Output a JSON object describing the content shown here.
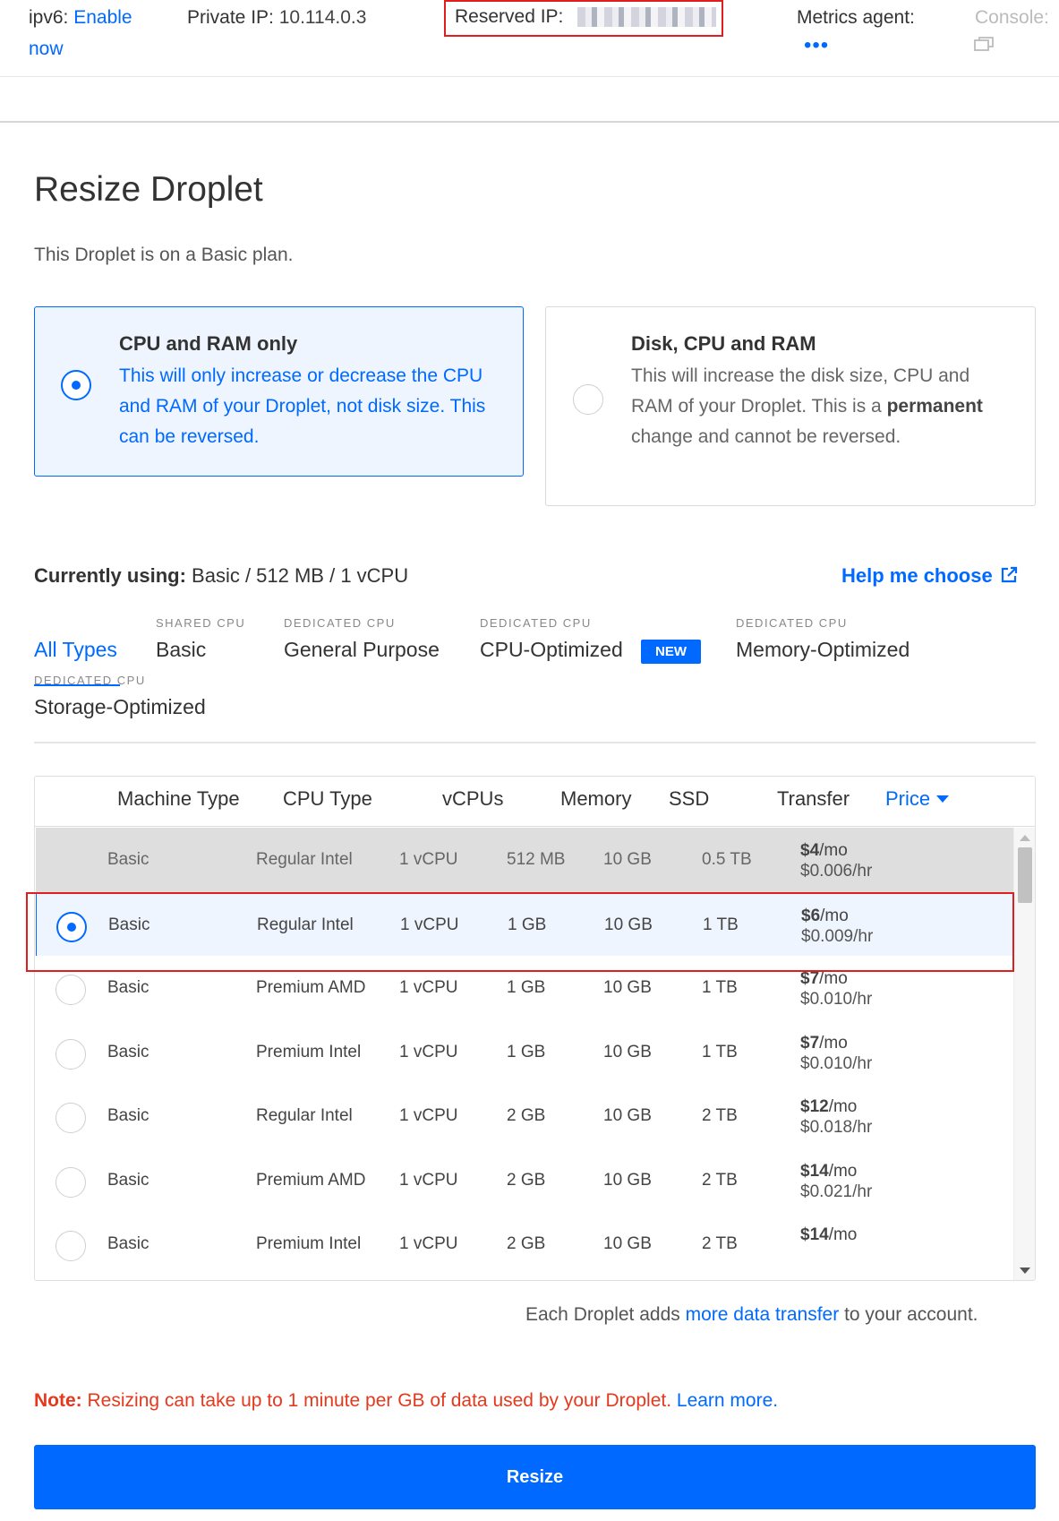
{
  "topbar": {
    "ipv6_label": "ipv6:",
    "ipv6_link": "Enable now",
    "private_ip_label": "Private IP:",
    "private_ip_value": "10.114.0.3",
    "reserved_ip_label": "Reserved IP:",
    "metrics_label": "Metrics agent:",
    "metrics_value": "•••",
    "console_label": "Console:"
  },
  "page": {
    "title": "Resize Droplet",
    "plan_note": "This Droplet is on a Basic plan."
  },
  "options": [
    {
      "title": "CPU and RAM only",
      "description": "This will only increase or decrease the CPU and RAM of your Droplet, not disk size. This can be reversed.",
      "selected": true
    },
    {
      "title": "Disk, CPU and RAM",
      "description_pre": "This will increase the disk size, CPU and RAM of your Droplet. This is a",
      "description_bold": "permanent",
      "description_post": "change and cannot be reversed.",
      "selected": false
    }
  ],
  "current": {
    "label": "Currently using:",
    "value": "Basic / 512 MB / 1 vCPU",
    "help_link": "Help me choose"
  },
  "tabs": [
    {
      "kicker": "",
      "label": "All Types",
      "active": true
    },
    {
      "kicker": "SHARED CPU",
      "label": "Basic",
      "active": false
    },
    {
      "kicker": "DEDICATED CPU",
      "label": "General Purpose",
      "active": false
    },
    {
      "kicker": "DEDICATED CPU",
      "label": "CPU-Optimized",
      "active": false,
      "badge": "NEW"
    },
    {
      "kicker": "DEDICATED CPU",
      "label": "Memory-Optimized",
      "active": false
    },
    {
      "kicker": "DEDICATED CPU",
      "label": "Storage-Optimized",
      "active": false
    }
  ],
  "table": {
    "headers": [
      "Machine Type",
      "CPU Type",
      "vCPUs",
      "Memory",
      "SSD",
      "Transfer",
      "Price"
    ],
    "rows": [
      {
        "machine": "Basic",
        "cpu": "Regular Intel",
        "vcpus": "1 vCPU",
        "memory": "512 MB",
        "ssd": "10 GB",
        "transfer": "0.5 TB",
        "price_mo": "$4",
        "price_mo_unit": "/mo",
        "price_hr": "$0.006/hr",
        "state": "current"
      },
      {
        "machine": "Basic",
        "cpu": "Regular Intel",
        "vcpus": "1 vCPU",
        "memory": "1 GB",
        "ssd": "10 GB",
        "transfer": "1 TB",
        "price_mo": "$6",
        "price_mo_unit": "/mo",
        "price_hr": "$0.009/hr",
        "state": "selected"
      },
      {
        "machine": "Basic",
        "cpu": "Premium AMD",
        "vcpus": "1 vCPU",
        "memory": "1 GB",
        "ssd": "10 GB",
        "transfer": "1 TB",
        "price_mo": "$7",
        "price_mo_unit": "/mo",
        "price_hr": "$0.010/hr",
        "state": "none"
      },
      {
        "machine": "Basic",
        "cpu": "Premium Intel",
        "vcpus": "1 vCPU",
        "memory": "1 GB",
        "ssd": "10 GB",
        "transfer": "1 TB",
        "price_mo": "$7",
        "price_mo_unit": "/mo",
        "price_hr": "$0.010/hr",
        "state": "none"
      },
      {
        "machine": "Basic",
        "cpu": "Regular Intel",
        "vcpus": "1 vCPU",
        "memory": "2 GB",
        "ssd": "10 GB",
        "transfer": "2 TB",
        "price_mo": "$12",
        "price_mo_unit": "/mo",
        "price_hr": "$0.018/hr",
        "state": "none"
      },
      {
        "machine": "Basic",
        "cpu": "Premium AMD",
        "vcpus": "1 vCPU",
        "memory": "2 GB",
        "ssd": "10 GB",
        "transfer": "2 TB",
        "price_mo": "$14",
        "price_mo_unit": "/mo",
        "price_hr": "$0.021/hr",
        "state": "none"
      },
      {
        "machine": "Basic",
        "cpu": "Premium Intel",
        "vcpus": "1 vCPU",
        "memory": "2 GB",
        "ssd": "10 GB",
        "transfer": "2 TB",
        "price_mo": "$14",
        "price_mo_unit": "/mo",
        "price_hr": "",
        "state": "none"
      }
    ]
  },
  "transfer_note": {
    "pre": "Each Droplet adds",
    "link": "more data transfer",
    "post": "to your account."
  },
  "note": {
    "label": "Note:",
    "text": "Resizing can take up to 1 minute per GB of data used by your Droplet.",
    "link": "Learn more."
  },
  "resize_button": "Resize",
  "colors": {
    "accent": "#0069ff",
    "warning": "#e5381d",
    "highlight_border": "#e01e1e"
  }
}
